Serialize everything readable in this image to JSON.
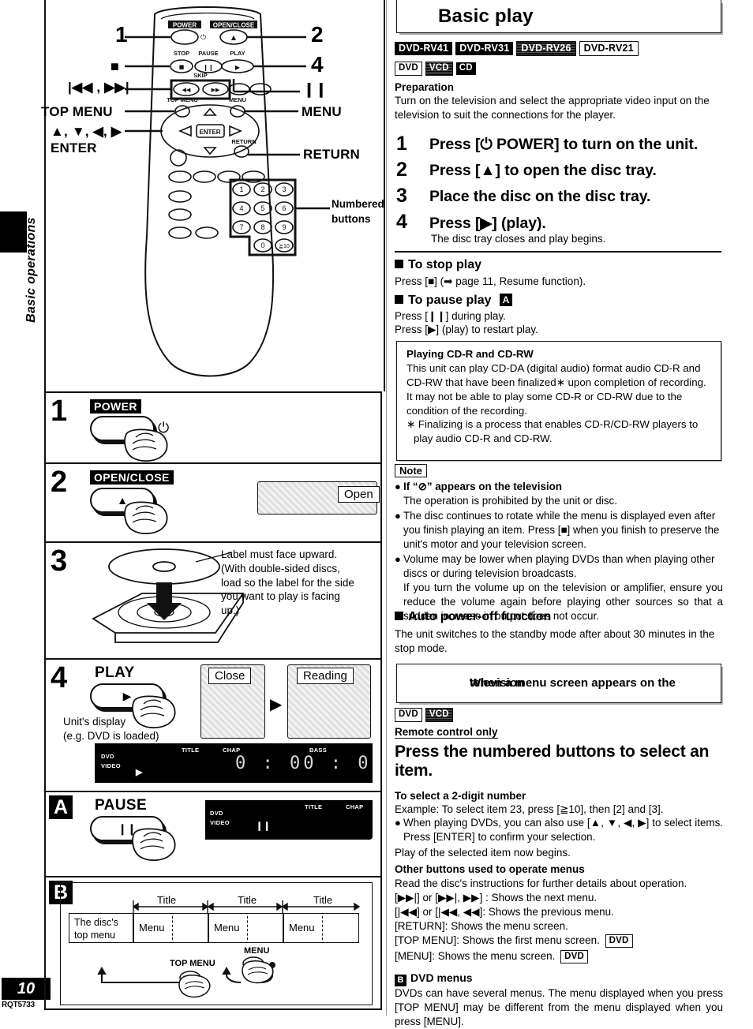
{
  "page": {
    "number": "10",
    "code": "RQT5733",
    "side_tab": "Basic operations"
  },
  "remote_diagram": {
    "callouts": {
      "num_1": "1",
      "num_2": "2",
      "num_4": "4",
      "stop_symbol": "■",
      "skip_symbol": "|◀◀ ,  ▶▶|",
      "pause_symbol": "❙❙",
      "top_menu": "TOP MENU",
      "menu": "MENU",
      "arrows_enter_line1": "▲, ▼, ◀, ▶",
      "arrows_enter_line2": "ENTER",
      "return": "RETURN",
      "numbered_buttons_line1": "Numbered",
      "numbered_buttons_line2": "buttons"
    },
    "remote_keys": {
      "power": "POWER",
      "open_close": "OPEN/CLOSE",
      "stop": "STOP",
      "pause": "PAUSE",
      "play": "PLAY",
      "skip": "SKIP",
      "top_menu": "TOP MENU",
      "menu": "MENU",
      "enter": "ENTER",
      "return": "RETURN",
      "numpad": [
        "1",
        "2",
        "3",
        "4",
        "5",
        "6",
        "7",
        "8",
        "9",
        "0",
        "≧10"
      ]
    }
  },
  "steps_left": [
    {
      "num": "1",
      "button_label": "POWER",
      "button_glyph": "",
      "side_glyph": "⏻"
    },
    {
      "num": "2",
      "button_label": "OPEN/CLOSE",
      "button_glyph": "▲",
      "tray_caption": "Open"
    },
    {
      "num": "3",
      "note_lines": [
        "Label must face upward.",
        "(With double-sided discs,",
        "load so the label for the side",
        "you want to play is facing",
        "up.)"
      ]
    },
    {
      "num": "4",
      "button_label": "PLAY",
      "button_glyph": "▶",
      "display_caption_line1": "Unit's display",
      "display_caption_line2": "(e.g. DVD is loaded)",
      "tray_caption_1": "Close",
      "tray_caption_2": "Reading",
      "lcd": {
        "mode_line1": "DVD",
        "mode_line2": "VIDEO",
        "play_glyph": "▶",
        "title_label": "TITLE",
        "chap_label": "CHAP",
        "bass_label": "BASS",
        "readout": "0 : 00 : 0"
      }
    },
    {
      "num": "A",
      "button_label": "PAUSE",
      "button_glyph": "❙❙",
      "lcd": {
        "mode_line1": "DVD",
        "mode_line2": "VIDEO",
        "pause_glyph": "❙❙",
        "title_label": "TITLE",
        "chap_label": "CHAP"
      }
    },
    {
      "num": "B",
      "flow": {
        "top_menu_cell": [
          "The disc's",
          "top menu"
        ],
        "title_labels": [
          "Title",
          "Title",
          "Title"
        ],
        "menu_cells": [
          "Menu",
          "Menu",
          "Menu"
        ],
        "button_top_menu": "TOP MENU",
        "button_menu": "MENU"
      }
    }
  ],
  "right": {
    "title": "Basic play",
    "models": [
      {
        "label": "DVD-RV41",
        "style": "solid"
      },
      {
        "label": "DVD-RV31",
        "style": "solid"
      },
      {
        "label": "DVD-RV26",
        "style": "dither"
      },
      {
        "label": "DVD-RV21",
        "style": "outline"
      }
    ],
    "media": [
      {
        "label": "DVD",
        "style": "outline"
      },
      {
        "label": "VCD",
        "style": "dither"
      },
      {
        "label": "CD",
        "style": "solid"
      }
    ],
    "preparation": {
      "heading": "Preparation",
      "body": "Turn on the television and select the appropriate video input on the television to suit the connections for the player."
    },
    "steps": [
      {
        "num": "1",
        "text": "Press [⏻ POWER] to turn on the unit."
      },
      {
        "num": "2",
        "text": "Press [▲] to open the disc tray."
      },
      {
        "num": "3",
        "text": "Place the disc on the disc tray."
      },
      {
        "num": "4",
        "text": "Press [▶] (play).",
        "sub": "The disc tray closes and play begins."
      }
    ],
    "stop_play": {
      "heading": "To stop play",
      "body": "Press [■] (➡ page 11, Resume function)."
    },
    "pause_play": {
      "heading": "To pause play",
      "badge": "A",
      "line1": "Press [❙❙] during play.",
      "line2": "Press [▶] (play) to restart play."
    },
    "cdr_box": {
      "heading": "Playing CD-R and CD-RW",
      "para1": "This unit can play CD-DA (digital audio) format audio CD-R and CD-RW that have been finalized∗ upon completion of recording.",
      "para2": "It may not be able to play some CD-R or CD-RW due to the condition of the recording.",
      "footnote": "∗ Finalizing is a process that enables CD-R/CD-RW players to play audio CD-R and CD-RW."
    },
    "note": {
      "badge": "Note",
      "bullets": [
        {
          "bold": "If “⊘” appears on the television",
          "rest": "The operation is prohibited by the unit or disc."
        },
        {
          "rest": "The disc continues to rotate while the menu is displayed even after you finish playing an item. Press [■] when you finish to preserve the unit's motor and your television screen."
        },
        {
          "rest": "Volume may be lower when playing DVDs than when playing other discs or during television broadcasts."
        },
        {
          "plain": "If you turn the volume up on the television or amplifier, ensure you reduce the volume again before playing other sources so that a sudden increase in output does not occur."
        }
      ]
    },
    "auto_power_off": {
      "heading": "Auto power-off function",
      "body": "The unit switches to the standby mode after about 30 minutes in the stop mode."
    },
    "menu_section": {
      "title_line1": "When a menu screen appears on the",
      "title_line2": "television",
      "media": [
        {
          "label": "DVD",
          "style": "outline"
        },
        {
          "label": "VCD",
          "style": "dither"
        }
      ],
      "remote_only": "Remote control only",
      "big_instruction": "Press the numbered buttons to select an item.",
      "two_digit_heading": "To select a 2-digit number",
      "example": "Example:  To select item 23, press [≧10], then [2] and [3].",
      "bullet": "When playing DVDs, you can also use [▲, ▼, ◀, ▶] to select items. Press [ENTER] to confirm your selection.",
      "play_begins": "Play of the selected item now begins."
    },
    "other_buttons": {
      "heading": "Other buttons used to operate menus",
      "intro": "Read the disc's instructions for further details about operation.",
      "lines": [
        "[▶▶|] or [▶▶|, ▶▶] : Shows the next menu.",
        "[|◀◀] or [|◀◀, ◀◀]: Shows the previous menu.",
        "[RETURN]: Shows the menu screen.",
        "[TOP MENU]: Shows the first menu screen.",
        "[MENU]: Shows the menu screen."
      ],
      "line_chips": [
        "",
        "",
        "",
        "DVD",
        "DVD"
      ]
    },
    "dvd_menus": {
      "badge": "B",
      "heading": "DVD menus",
      "body": "DVDs can have several menus. The menu displayed when you press [TOP MENU] may be different from the menu displayed when you press [MENU]."
    }
  }
}
